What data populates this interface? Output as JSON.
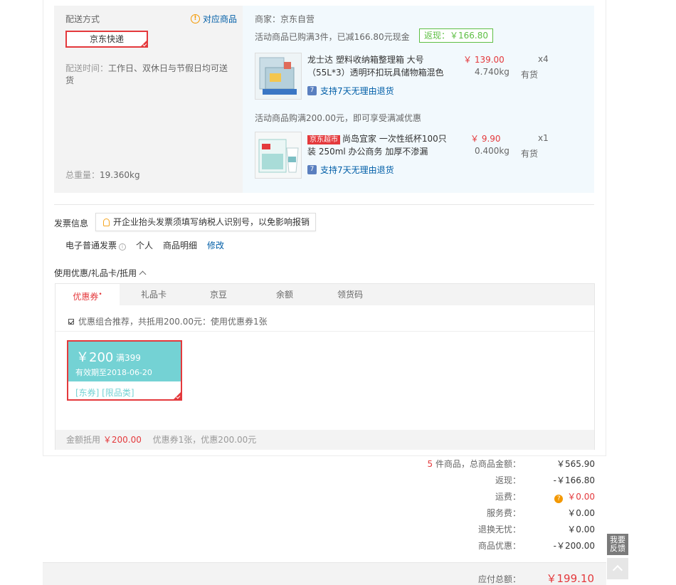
{
  "shipping": {
    "method_title": "配送方式",
    "goods_link": "对应商品",
    "express": "京东快递",
    "time_label": "配送时间：",
    "time_value": "工作日、双休日与节假日均可送货",
    "weight_label": "总重量：",
    "weight_value": "19.360kg"
  },
  "seller": {
    "name": "商家：京东自营",
    "promo1": "活动商品已购满3件，已减166.80元现金",
    "rebate": "返现：￥166.80",
    "promo2": "活动商品购满200.00元，即可享受满减优惠",
    "items": [
      {
        "name": "龙士达 塑料收纳箱整理箱 大号（55L*3）透明环扣玩具储物箱混色",
        "badge": "",
        "return_text": "支持7天无理由退货",
        "price": "￥ 139.00",
        "weight": "4.740kg",
        "qty": "x4",
        "stock": "有货"
      },
      {
        "name": "尚岛宜家 一次性纸杯100只装 250ml 办公商务 加厚不渗漏",
        "badge": "京东超市",
        "return_text": "支持7天无理由退货",
        "price": "￥ 9.90",
        "weight": "0.400kg",
        "qty": "x1",
        "stock": "有货"
      }
    ]
  },
  "invoice": {
    "title": "发票信息",
    "tip": "开企业抬头发票须填写纳税人识别号，以免影响报销",
    "type": "电子普通发票",
    "header": "个人",
    "content": "商品明细",
    "modify": "修改"
  },
  "coupons": {
    "title": "使用优惠/礼品卡/抵用",
    "tabs": [
      "优惠券",
      "礼品卡",
      "京豆",
      "余额",
      "领货码"
    ],
    "active_tab_mark": "•",
    "recommend": "优惠组合推荐，共抵用200.00元：使用优惠券1张",
    "coupon": {
      "amount": "￥200",
      "condition": "满399",
      "valid": "有效期至2018-06-20",
      "tags": "[东券]  [限品类]"
    },
    "footer_label": "金额抵用",
    "footer_amount": "￥200.00",
    "footer_detail": "优惠券1张，优惠200.00元"
  },
  "summary": {
    "count": "5",
    "count_label": "件商品，总商品金额：",
    "total_goods": "￥565.90",
    "rebate_label": "返现：",
    "rebate_value": "-￥166.80",
    "freight_label": "运费：",
    "freight_value": "￥0.00",
    "service_label": "服务费：",
    "service_value": "￥0.00",
    "return_label": "退换无忧：",
    "return_value": "￥0.00",
    "discount_label": "商品优惠：",
    "discount_value": "-￥200.00",
    "payable_label": "应付总额：",
    "payable_value": "￥199.10"
  },
  "side": {
    "feedback": "我要反馈"
  },
  "colors": {
    "accent_red": "#e4393c",
    "link_blue": "#005ea7",
    "coupon_teal": "#74d2d4",
    "rebate_green": "#5ebf44"
  }
}
